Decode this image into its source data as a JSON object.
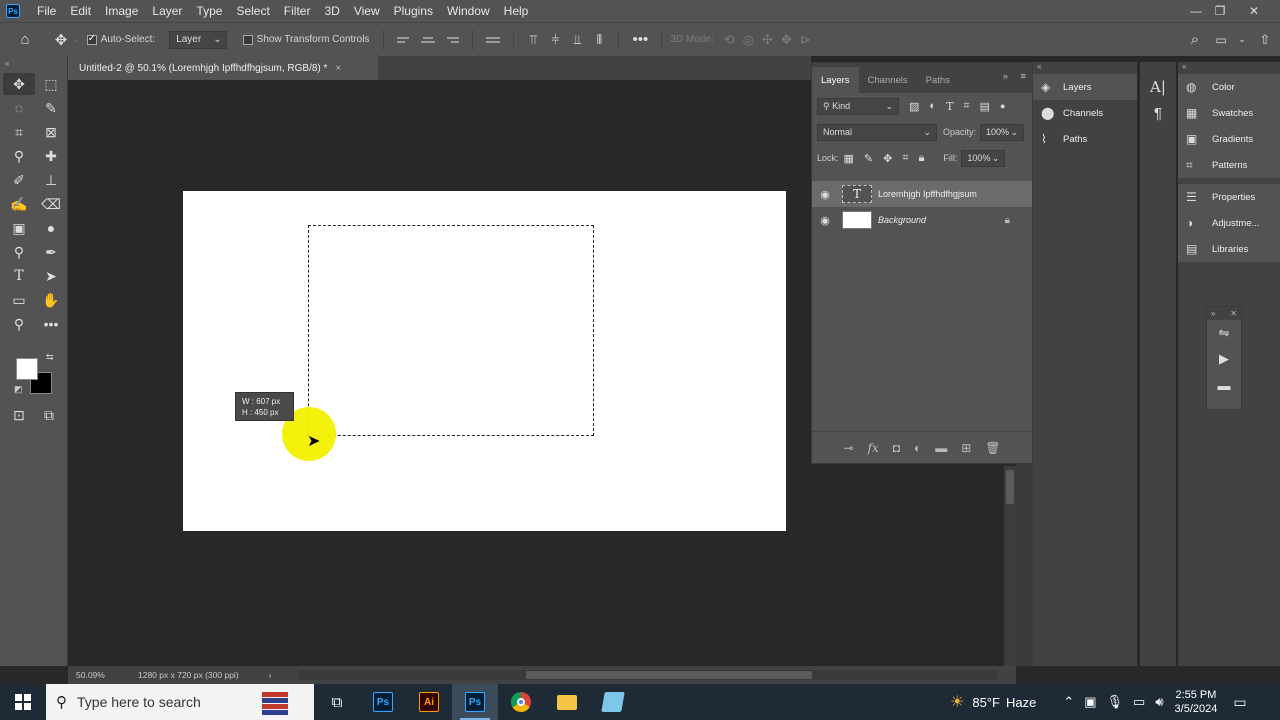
{
  "menubar": {
    "logo": "Ps",
    "items": [
      "File",
      "Edit",
      "Image",
      "Layer",
      "Type",
      "Select",
      "Filter",
      "3D",
      "View",
      "Plugins",
      "Window",
      "Help"
    ]
  },
  "options": {
    "auto_select_label": "Auto-Select:",
    "auto_select_value": "Layer",
    "transform_label": "Show Transform Controls",
    "mode_3d_label": "3D Mode:"
  },
  "document": {
    "tab_title": "Untitled-2 @ 50.1% (Loremhjgh Ipffhdfhgjsum, RGB/8) *",
    "size_tip_w": "W :   607 px",
    "size_tip_h": "H :   450 px",
    "zoom": "50.09%",
    "doc_info": "1280 px x 720 px (300 ppi)"
  },
  "layers_panel": {
    "tabs": [
      "Layers",
      "Channels",
      "Paths"
    ],
    "kind_label": "Kind",
    "blend_mode": "Normal",
    "opacity_label": "Opacity:",
    "opacity_value": "100%",
    "lock_label": "Lock:",
    "fill_label": "Fill:",
    "fill_value": "100%",
    "layers": [
      {
        "name": "Loremhjgh Ipffhdfhgjsum",
        "type": "text"
      },
      {
        "name": "Background",
        "type": "background"
      }
    ]
  },
  "collapsed_panels": {
    "group1": [
      "Layers",
      "Channels",
      "Paths"
    ],
    "group2": [
      "Color",
      "Swatches",
      "Gradients",
      "Patterns"
    ],
    "group3": [
      "Properties",
      "Adjustme...",
      "Libraries"
    ]
  },
  "taskbar": {
    "search_placeholder": "Type here to search",
    "weather_temp": "85°F",
    "weather_desc": "Haze",
    "time": "2:55 PM",
    "date": "3/5/2024"
  },
  "colors": {
    "ui_dark": "#282828",
    "ui_panel": "#535353",
    "highlight": "#f3f000",
    "taskbar": "#1e2a36"
  }
}
